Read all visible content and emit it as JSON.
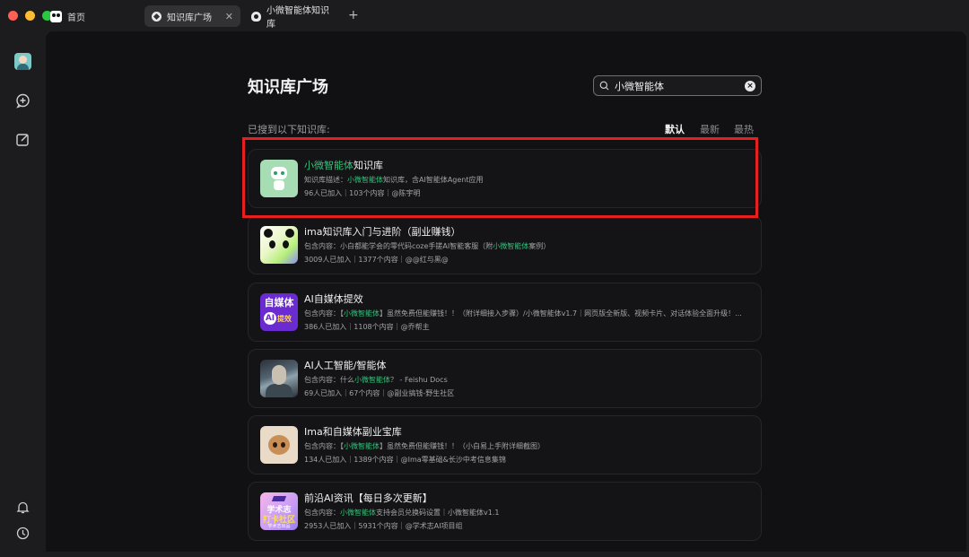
{
  "tabs": {
    "home_label": "首页",
    "tab1_label": "知识库广场",
    "tab2_label": "小微智能体知识库",
    "new_tab": "+",
    "close": "✕"
  },
  "page": {
    "title": "知识库广场",
    "result_label": "已搜到以下知识库:",
    "sort": [
      "默认",
      "最新",
      "最热"
    ],
    "search_value": "小微智能体",
    "search_clear": "×"
  },
  "cards": [
    {
      "thumb": "robot",
      "title_hl": "小微智能体",
      "title_rest": "知识库",
      "desc_pre": "知识库描述：",
      "desc_hl": "小微智能体",
      "desc_post": "知识库，含AI智能体Agent应用",
      "meta": "96人已加入｜103个内容｜@陈宇明"
    },
    {
      "thumb": "panda",
      "title_hl": "",
      "title_rest": "ima知识库入门与进阶（副业赚钱）",
      "desc_pre": "包含内容：小白都能学会的零代码coze手搓AI智能客服（附",
      "desc_hl": "小微智能体",
      "desc_post": "案例）",
      "meta": "3009人已加入｜1377个内容｜@@红与黑@"
    },
    {
      "thumb": "media",
      "thumb_text": [
        "自媒体",
        "AI",
        "提效"
      ],
      "title_hl": "",
      "title_rest": "AI自媒体提效",
      "desc_pre": "包含内容：【",
      "desc_hl": "小微智能体",
      "desc_post": "】虽然免费但能赚钱！！（附详细接入步骤）/小微智能体v1.7｜网页版全新版、视频卡片、对话体验全面升级！...",
      "meta": "386人已加入｜1108个内容｜@乔帮主"
    },
    {
      "thumb": "ai",
      "title_hl": "",
      "title_rest": "AI人工智能/智能体",
      "desc_pre": "包含内容：什么",
      "desc_hl": "小微智能体",
      "desc_post": "？ - Feishu Docs",
      "meta": "69人已加入｜67个内容｜@副业搞钱-野生社区"
    },
    {
      "thumb": "cat",
      "title_hl": "",
      "title_rest": "Ima和自媒体副业宝库",
      "desc_pre": "包含内容：【",
      "desc_hl": "小微智能体",
      "desc_post": "】虽然免费但能赚钱！！（小白易上手附详细截图）",
      "meta": "134人已加入｜1389个内容｜@Ima零基础&长沙中考信息集锦"
    },
    {
      "thumb": "edu",
      "thumb_text": [
        "学术志",
        "打卡社区",
        "学术志出品"
      ],
      "title_hl": "",
      "title_rest": "前沿AI资讯【每日多次更新】",
      "desc_pre": "包含内容：",
      "desc_hl": "小微智能体",
      "desc_post": "支持会员兑换码设置｜小微智能体v1.1",
      "meta": "2953人已加入｜5931个内容｜@学术志AI项目组"
    }
  ],
  "colors": {
    "highlight_text": "#33c27a",
    "annotation_box": "#e5201f",
    "background": "#111113"
  }
}
